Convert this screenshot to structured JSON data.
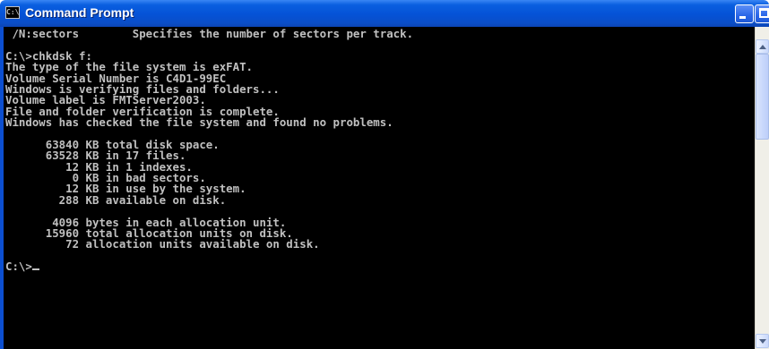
{
  "window": {
    "title": "Command Prompt",
    "icon_label": "C:\\"
  },
  "controls": [
    "minimize-icon",
    "maximize-icon"
  ],
  "console": {
    "lines": [
      " /N:sectors        Specifies the number of sectors per track.",
      "",
      "C:\\>chkdsk f:",
      "The type of the file system is exFAT.",
      "Volume Serial Number is C4D1-99EC",
      "Windows is verifying files and folders...",
      "Volume label is FMTServer2003.",
      "File and folder verification is complete.",
      "Windows has checked the file system and found no problems.",
      "",
      "      63840 KB total disk space.",
      "      63528 KB in 17 files.",
      "         12 KB in 1 indexes.",
      "          0 KB in bad sectors.",
      "         12 KB in use by the system.",
      "        288 KB available on disk.",
      "",
      "       4096 bytes in each allocation unit.",
      "      15960 total allocation units on disk.",
      "         72 allocation units available on disk.",
      "",
      "C:\\>"
    ]
  },
  "colors": {
    "console_bg": "#000000",
    "console_fg": "#c0c0c0",
    "titlebar": "#0552d6"
  }
}
